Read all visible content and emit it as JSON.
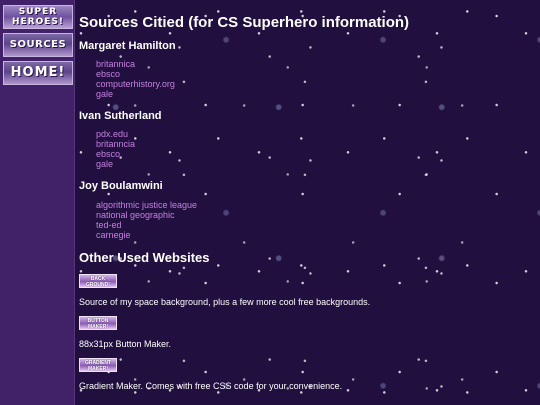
{
  "nav": {
    "logo_label": "SUPER HEROES!",
    "sources_label": "SOURCES",
    "home_label": "HOME!"
  },
  "main": {
    "title": "Sources Citied (for CS Superhero information)",
    "sections": [
      {
        "name": "Margaret Hamilton",
        "links": [
          "britannica",
          "ebsco",
          "computerhistory.org",
          "gale"
        ]
      },
      {
        "name": "Ivan Sutherland",
        "links": [
          "pdx.edu",
          "britanncia",
          "ebsco",
          "gale"
        ]
      },
      {
        "name": "Joy Boulamwini",
        "links": [
          "algorithmic justice league",
          "national geographic",
          "ted-ed",
          "carnegie"
        ]
      }
    ],
    "other_title": "Other Used Websites",
    "websites": [
      {
        "badge": "BACK GROUND!",
        "description": "Source of my space background, plus a few more cool free backgrounds."
      },
      {
        "badge": "BUTTON MAKER!",
        "description": "88x31px Button Maker."
      },
      {
        "badge": "GRADIENT MAKER!",
        "description": "Gradient Maker. Comes with free CSS code for your convenience."
      }
    ]
  },
  "colors": {
    "background": "#21103f",
    "sidebar": "#412268",
    "link": "#c67fe0",
    "text": "#ffffff"
  }
}
